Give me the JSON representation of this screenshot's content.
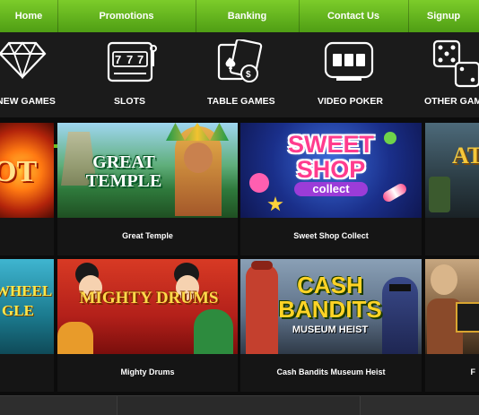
{
  "nav": {
    "items": [
      {
        "label": "Home"
      },
      {
        "label": "Promotions"
      },
      {
        "label": "Banking"
      },
      {
        "label": "Contact Us"
      },
      {
        "label": "Signup"
      }
    ]
  },
  "categories": [
    {
      "label": "NEW GAMES",
      "icon": "diamond-icon"
    },
    {
      "label": "SLOTS",
      "icon": "slot-machine-icon"
    },
    {
      "label": "TABLE GAMES",
      "icon": "cards-chip-icon"
    },
    {
      "label": "VIDEO POKER",
      "icon": "video-poker-icon"
    },
    {
      "label": "OTHER GAMES",
      "icon": "dice-icon"
    }
  ],
  "games": {
    "row1": [
      {
        "art": "OT",
        "title": ""
      },
      {
        "art": "GREAT TEMPLE",
        "title": "Great Temple"
      },
      {
        "art": "SWEET SHOP",
        "subtitle": "collect",
        "title": "Sweet Shop Collect"
      },
      {
        "art": "AT",
        "title": ""
      }
    ],
    "row2": [
      {
        "art": "WHEEL",
        "art2": "GLE",
        "title": ""
      },
      {
        "art": "MIGHTY DRUMS",
        "title": "Mighty Drums"
      },
      {
        "art": "CASH BANDITS",
        "subtitle": "MUSEUM HEIST",
        "title": "Cash Bandits Museum Heist"
      },
      {
        "art": "",
        "title": "F"
      }
    ]
  },
  "colors": {
    "nav_green": "#5fb31c",
    "active_underline": "#6fbf26",
    "background": "#0c0c0c"
  }
}
